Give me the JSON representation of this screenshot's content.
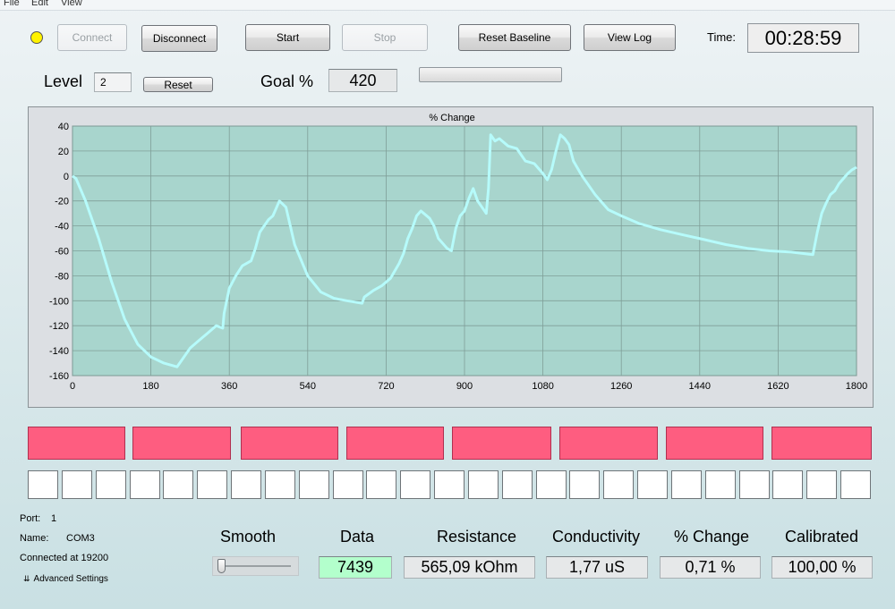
{
  "menu": [
    "File",
    "Edit",
    "View"
  ],
  "toolbar": {
    "connect": "Connect",
    "disconnect": "Disconnect",
    "start": "Start",
    "stop": "Stop",
    "reset_baseline": "Reset Baseline",
    "view_log": "View Log",
    "time_label": "Time:",
    "time_value": "00:28:59",
    "status_led_color": "#fff200"
  },
  "level": {
    "label": "Level",
    "value": "2",
    "reset": "Reset"
  },
  "goal": {
    "label": "Goal %",
    "value": "420",
    "progress": 0
  },
  "chart_data": {
    "type": "line",
    "title": "% Change",
    "xlabel": "",
    "ylabel": "",
    "xlim": [
      0,
      1800
    ],
    "ylim": [
      -160,
      40
    ],
    "x_ticks": [
      0,
      180,
      360,
      540,
      720,
      900,
      1080,
      1260,
      1440,
      1620,
      1800
    ],
    "y_ticks": [
      40,
      20,
      0,
      -20,
      -40,
      -60,
      -80,
      -100,
      -120,
      -140,
      -160
    ],
    "grid": true,
    "line_color": "#b6fbfb",
    "plot_background": "#a8d5cd",
    "series": [
      {
        "x": [
          0,
          8,
          30,
          60,
          90,
          120,
          150,
          180,
          210,
          240,
          250,
          270,
          290,
          310,
          330,
          345,
          348,
          360,
          375,
          390,
          410,
          420,
          430,
          450,
          460,
          475,
          490,
          510,
          540,
          570,
          600,
          630,
          665,
          670,
          690,
          710,
          730,
          750,
          760,
          770,
          780,
          790,
          800,
          820,
          830,
          840,
          860,
          870,
          880,
          890,
          900,
          910,
          920,
          930,
          940,
          950,
          955,
          960,
          970,
          980,
          1000,
          1020,
          1040,
          1060,
          1080,
          1090,
          1100,
          1110,
          1120,
          1130,
          1140,
          1150,
          1170,
          1200,
          1230,
          1260,
          1300,
          1350,
          1400,
          1450,
          1500,
          1550,
          1600,
          1650,
          1700,
          1710,
          1720,
          1730,
          1740,
          1750,
          1760,
          1770,
          1780,
          1790,
          1800
        ],
        "values": [
          0,
          -2,
          -20,
          -50,
          -85,
          -115,
          -135,
          -145,
          -150,
          -153,
          -148,
          -138,
          -132,
          -126,
          -120,
          -122,
          -110,
          -90,
          -80,
          -72,
          -68,
          -58,
          -45,
          -35,
          -32,
          -20,
          -25,
          -55,
          -80,
          -93,
          -98,
          -100,
          -102,
          -97,
          -92,
          -88,
          -82,
          -70,
          -62,
          -50,
          -42,
          -32,
          -28,
          -34,
          -40,
          -50,
          -58,
          -60,
          -42,
          -32,
          -28,
          -18,
          -10,
          -20,
          -25,
          -30,
          -10,
          33,
          28,
          30,
          24,
          22,
          12,
          10,
          2,
          -3,
          5,
          20,
          33,
          30,
          25,
          12,
          0,
          -15,
          -27,
          -32,
          -38,
          -43,
          -47,
          -51,
          -55,
          -58,
          -60,
          -61,
          -63,
          -45,
          -30,
          -22,
          -15,
          -12,
          -6,
          -2,
          2,
          5,
          7
        ]
      }
    ]
  },
  "indicators": {
    "red_count": 8,
    "white_count": 25,
    "red_color": "#fe5d80"
  },
  "port": {
    "port_label": "Port:",
    "port_value": "1",
    "name_label": "Name:",
    "name_value": "COM3",
    "connected": "Connected at 19200",
    "advanced": "Advanced Settings"
  },
  "metrics": {
    "smooth": "Smooth",
    "smooth_level": 0,
    "data_label": "Data",
    "data_value": "7439",
    "data_bg": "#b3ffcc",
    "resistance_label": "Resistance",
    "resistance_value": "565,09 kOhm",
    "conductivity_label": "Conductivity",
    "conductivity_value": "1,77 uS",
    "change_label": "% Change",
    "change_value": "0,71 %",
    "calibrated_label": "Calibrated",
    "calibrated_value": "100,00 %"
  }
}
